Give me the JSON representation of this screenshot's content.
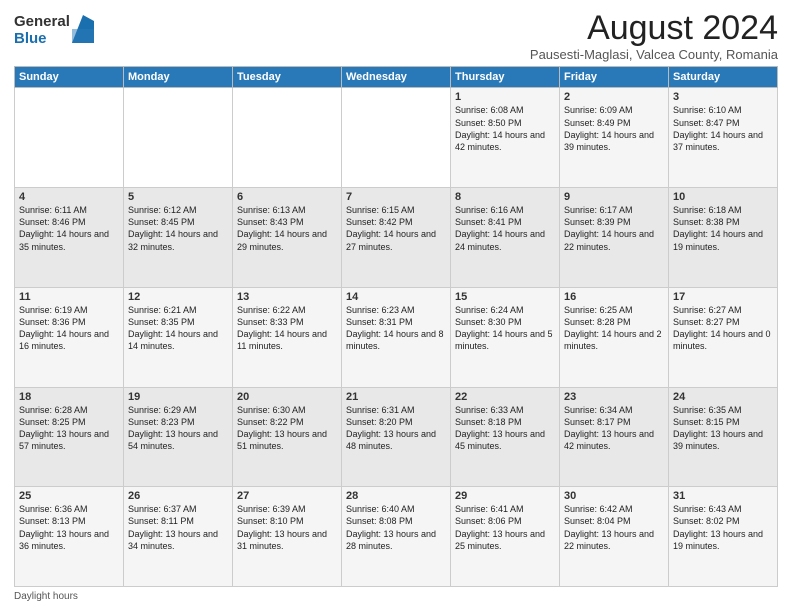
{
  "logo": {
    "general": "General",
    "blue": "Blue"
  },
  "title": "August 2024",
  "subtitle": "Pausesti-Maglasi, Valcea County, Romania",
  "header_days": [
    "Sunday",
    "Monday",
    "Tuesday",
    "Wednesday",
    "Thursday",
    "Friday",
    "Saturday"
  ],
  "weeks": [
    [
      {
        "day": "",
        "info": ""
      },
      {
        "day": "",
        "info": ""
      },
      {
        "day": "",
        "info": ""
      },
      {
        "day": "",
        "info": ""
      },
      {
        "day": "1",
        "info": "Sunrise: 6:08 AM\nSunset: 8:50 PM\nDaylight: 14 hours and 42 minutes."
      },
      {
        "day": "2",
        "info": "Sunrise: 6:09 AM\nSunset: 8:49 PM\nDaylight: 14 hours and 39 minutes."
      },
      {
        "day": "3",
        "info": "Sunrise: 6:10 AM\nSunset: 8:47 PM\nDaylight: 14 hours and 37 minutes."
      }
    ],
    [
      {
        "day": "4",
        "info": "Sunrise: 6:11 AM\nSunset: 8:46 PM\nDaylight: 14 hours and 35 minutes."
      },
      {
        "day": "5",
        "info": "Sunrise: 6:12 AM\nSunset: 8:45 PM\nDaylight: 14 hours and 32 minutes."
      },
      {
        "day": "6",
        "info": "Sunrise: 6:13 AM\nSunset: 8:43 PM\nDaylight: 14 hours and 29 minutes."
      },
      {
        "day": "7",
        "info": "Sunrise: 6:15 AM\nSunset: 8:42 PM\nDaylight: 14 hours and 27 minutes."
      },
      {
        "day": "8",
        "info": "Sunrise: 6:16 AM\nSunset: 8:41 PM\nDaylight: 14 hours and 24 minutes."
      },
      {
        "day": "9",
        "info": "Sunrise: 6:17 AM\nSunset: 8:39 PM\nDaylight: 14 hours and 22 minutes."
      },
      {
        "day": "10",
        "info": "Sunrise: 6:18 AM\nSunset: 8:38 PM\nDaylight: 14 hours and 19 minutes."
      }
    ],
    [
      {
        "day": "11",
        "info": "Sunrise: 6:19 AM\nSunset: 8:36 PM\nDaylight: 14 hours and 16 minutes."
      },
      {
        "day": "12",
        "info": "Sunrise: 6:21 AM\nSunset: 8:35 PM\nDaylight: 14 hours and 14 minutes."
      },
      {
        "day": "13",
        "info": "Sunrise: 6:22 AM\nSunset: 8:33 PM\nDaylight: 14 hours and 11 minutes."
      },
      {
        "day": "14",
        "info": "Sunrise: 6:23 AM\nSunset: 8:31 PM\nDaylight: 14 hours and 8 minutes."
      },
      {
        "day": "15",
        "info": "Sunrise: 6:24 AM\nSunset: 8:30 PM\nDaylight: 14 hours and 5 minutes."
      },
      {
        "day": "16",
        "info": "Sunrise: 6:25 AM\nSunset: 8:28 PM\nDaylight: 14 hours and 2 minutes."
      },
      {
        "day": "17",
        "info": "Sunrise: 6:27 AM\nSunset: 8:27 PM\nDaylight: 14 hours and 0 minutes."
      }
    ],
    [
      {
        "day": "18",
        "info": "Sunrise: 6:28 AM\nSunset: 8:25 PM\nDaylight: 13 hours and 57 minutes."
      },
      {
        "day": "19",
        "info": "Sunrise: 6:29 AM\nSunset: 8:23 PM\nDaylight: 13 hours and 54 minutes."
      },
      {
        "day": "20",
        "info": "Sunrise: 6:30 AM\nSunset: 8:22 PM\nDaylight: 13 hours and 51 minutes."
      },
      {
        "day": "21",
        "info": "Sunrise: 6:31 AM\nSunset: 8:20 PM\nDaylight: 13 hours and 48 minutes."
      },
      {
        "day": "22",
        "info": "Sunrise: 6:33 AM\nSunset: 8:18 PM\nDaylight: 13 hours and 45 minutes."
      },
      {
        "day": "23",
        "info": "Sunrise: 6:34 AM\nSunset: 8:17 PM\nDaylight: 13 hours and 42 minutes."
      },
      {
        "day": "24",
        "info": "Sunrise: 6:35 AM\nSunset: 8:15 PM\nDaylight: 13 hours and 39 minutes."
      }
    ],
    [
      {
        "day": "25",
        "info": "Sunrise: 6:36 AM\nSunset: 8:13 PM\nDaylight: 13 hours and 36 minutes."
      },
      {
        "day": "26",
        "info": "Sunrise: 6:37 AM\nSunset: 8:11 PM\nDaylight: 13 hours and 34 minutes."
      },
      {
        "day": "27",
        "info": "Sunrise: 6:39 AM\nSunset: 8:10 PM\nDaylight: 13 hours and 31 minutes."
      },
      {
        "day": "28",
        "info": "Sunrise: 6:40 AM\nSunset: 8:08 PM\nDaylight: 13 hours and 28 minutes."
      },
      {
        "day": "29",
        "info": "Sunrise: 6:41 AM\nSunset: 8:06 PM\nDaylight: 13 hours and 25 minutes."
      },
      {
        "day": "30",
        "info": "Sunrise: 6:42 AM\nSunset: 8:04 PM\nDaylight: 13 hours and 22 minutes."
      },
      {
        "day": "31",
        "info": "Sunrise: 6:43 AM\nSunset: 8:02 PM\nDaylight: 13 hours and 19 minutes."
      }
    ]
  ],
  "footer": "Daylight hours"
}
